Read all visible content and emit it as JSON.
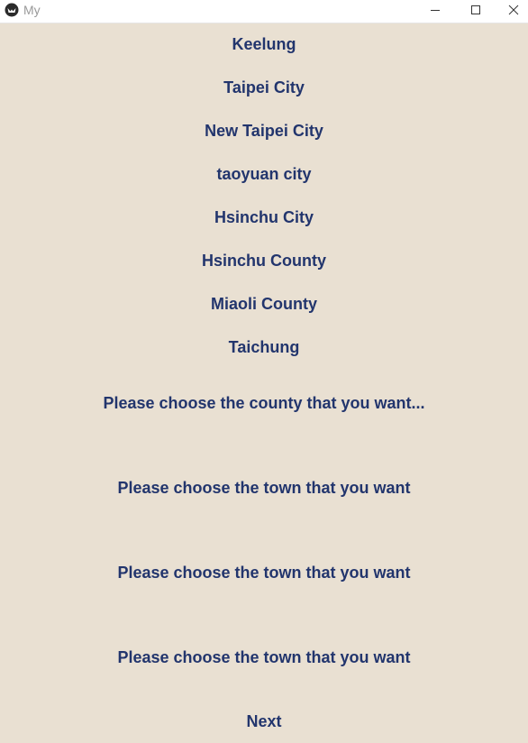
{
  "window": {
    "title": "My"
  },
  "cities": [
    {
      "label": "Keelung"
    },
    {
      "label": "Taipei City"
    },
    {
      "label": "New Taipei City"
    },
    {
      "label": "taoyuan city"
    },
    {
      "label": "Hsinchu City"
    },
    {
      "label": "Hsinchu County"
    },
    {
      "label": "Miaoli County"
    },
    {
      "label": "Taichung"
    }
  ],
  "county_prompt": "Please choose the county that you want...",
  "town_prompts": [
    "Please choose the town that you want",
    "Please choose the town that you want",
    "Please choose the town that you want"
  ],
  "next_label": "Next",
  "colors": {
    "background": "#e9e0d2",
    "text": "#22356d",
    "titlebar": "#ffffff"
  },
  "icons": {
    "app": "kivy-app-icon",
    "minimize": "minimize-icon",
    "maximize": "maximize-icon",
    "close": "close-icon"
  }
}
